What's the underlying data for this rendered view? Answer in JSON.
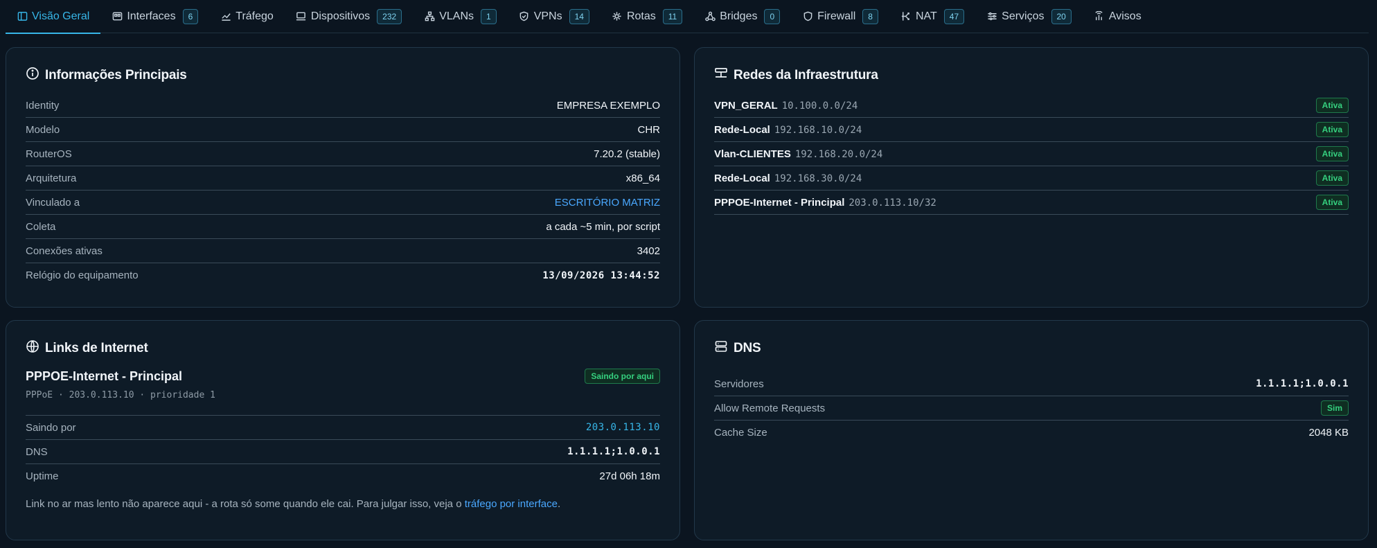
{
  "tabs": [
    {
      "label": "Visão Geral",
      "icon": "overview-icon",
      "active": true
    },
    {
      "label": "Interfaces",
      "icon": "interfaces-icon",
      "count": "6"
    },
    {
      "label": "Tráfego",
      "icon": "traffic-icon"
    },
    {
      "label": "Dispositivos",
      "icon": "devices-icon",
      "count": "232"
    },
    {
      "label": "VLANs",
      "icon": "vlans-icon",
      "count": "1"
    },
    {
      "label": "VPNs",
      "icon": "vpns-icon",
      "count": "14"
    },
    {
      "label": "Rotas",
      "icon": "routes-icon",
      "count": "11"
    },
    {
      "label": "Bridges",
      "icon": "bridges-icon",
      "count": "0"
    },
    {
      "label": "Firewall",
      "icon": "firewall-icon",
      "count": "8"
    },
    {
      "label": "NAT",
      "icon": "nat-icon",
      "count": "47"
    },
    {
      "label": "Serviços",
      "icon": "services-icon",
      "count": "20"
    },
    {
      "label": "Avisos",
      "icon": "alerts-icon"
    }
  ],
  "info": {
    "title": "Informações Principais",
    "rows": [
      {
        "label": "Identity",
        "value": "EMPRESA EXEMPLO"
      },
      {
        "label": "Modelo",
        "value": "CHR"
      },
      {
        "label": "RouterOS",
        "value": "7.20.2 (stable)"
      },
      {
        "label": "Arquitetura",
        "value": "x86_64"
      },
      {
        "label": "Vinculado a",
        "value": "ESCRITÓRIO MATRIZ"
      },
      {
        "label": "Coleta",
        "value": "a cada ~5 min, por script"
      },
      {
        "label": "Conexões ativas",
        "value": "3402"
      },
      {
        "label": "Relógio do equipamento",
        "value": "13/09/2026 13:44:52"
      }
    ]
  },
  "networks": {
    "title": "Redes da Infraestrutura",
    "items": [
      {
        "name": "VPN_GERAL",
        "cidr": "10.100.0.0/24",
        "status": "Ativa"
      },
      {
        "name": "Rede-Local",
        "cidr": "192.168.10.0/24",
        "status": "Ativa"
      },
      {
        "name": "Vlan-CLIENTES",
        "cidr": "192.168.20.0/24",
        "status": "Ativa"
      },
      {
        "name": "Rede-Local",
        "cidr": "192.168.30.0/24",
        "status": "Ativa"
      },
      {
        "name": "PPPOE-Internet - Principal",
        "cidr": "203.0.113.10/32",
        "status": "Ativa"
      }
    ]
  },
  "links": {
    "title": "Links de Internet",
    "name": "PPPOE-Internet - Principal",
    "badge": "Saindo por aqui",
    "meta": "PPPoE · 203.0.113.10 · prioridade 1",
    "rows": [
      {
        "label": "Saindo por",
        "value": "203.0.113.10"
      },
      {
        "label": "DNS",
        "value": "1.1.1.1;1.0.0.1"
      },
      {
        "label": "Uptime",
        "value": "27d 06h 18m"
      }
    ],
    "note_text": "Link no ar mas lento não aparece aqui - a rota só some quando ele cai. Para julgar isso, veja o ",
    "note_link": "tráfego por interface",
    "note_end": "."
  },
  "dns": {
    "title": "DNS",
    "rows": [
      {
        "label": "Servidores",
        "value": "1.1.1.1;1.0.0.1"
      },
      {
        "label": "Allow Remote Requests",
        "value": "Sim"
      },
      {
        "label": "Cache Size",
        "value": "2048 KB"
      }
    ]
  },
  "colors": {
    "accent": "#37b6e8",
    "link": "#4aa8ff",
    "success": "#35d07f",
    "background": "#0b1520",
    "card": "#0e1b27"
  }
}
